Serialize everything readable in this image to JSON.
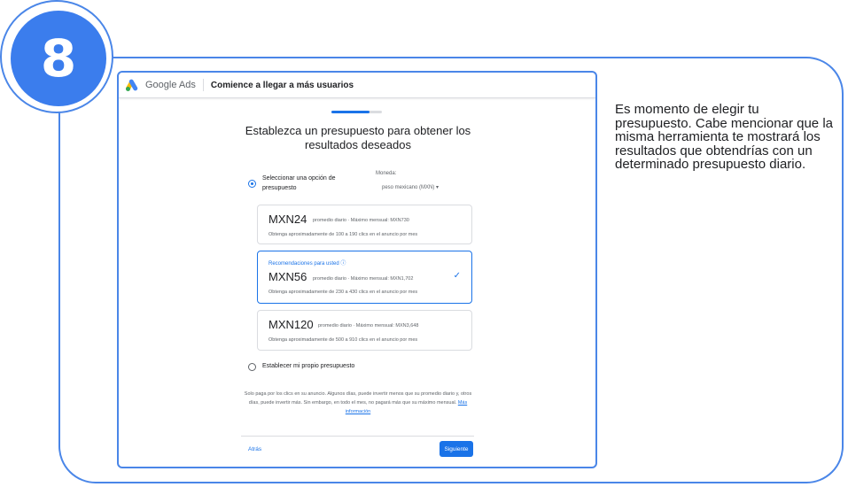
{
  "step": {
    "number": "8"
  },
  "app": {
    "brand": "Google Ads",
    "title": "Comience a llegar a más usuarios"
  },
  "progress": {
    "fraction": 0.75
  },
  "heading": "Establezca un presupuesto para obtener los resultados deseados",
  "budget_option": {
    "label": "Seleccionar una opción de presupuesto",
    "currency_label": "Moneda:",
    "currency_value": "peso mexicano (MXN) ▾"
  },
  "options": [
    {
      "amount": "MXN24",
      "meta": "promedio diario · Máximo mensual: MXN730",
      "clicks": "Obtenga aproximadamente de 100 a 190 clics en el anuncio por mes"
    },
    {
      "recommended": "Recomendaciones para usted ⓘ",
      "amount": "MXN56",
      "meta": "promedio diario · Máximo mensual: MXN1,702",
      "clicks": "Obtenga aproximadamente de 230 a 430 clics en el anuncio por mes",
      "check": "✓"
    },
    {
      "amount": "MXN120",
      "meta": "promedio diario · Máximo mensual: MXN3,648",
      "clicks": "Obtenga aproximadamente de 500 a 910 clics en el anuncio por mes"
    }
  ],
  "own_budget": "Establecer mi propio presupuesto",
  "footnote": {
    "text": "Solo paga por los clics en su anuncio. Algunos días, puede invertir menos que su promedio diario y, otros días, puede invertir más. Sin embargo, en todo el mes, no pagará más que su máximo mensual.",
    "link": "Más información"
  },
  "nav": {
    "back": "Atrás",
    "next": "Siguiente"
  },
  "description": "Es momento de elegir tu presupuesto. Cabe mencionar que la misma herramienta te mostrará los resultados que obtendrías con un determinado presupuesto diario.",
  "colors": {
    "accent": "#1a73e8",
    "frame": "#4a86e8",
    "badge": "#3b7ded"
  }
}
